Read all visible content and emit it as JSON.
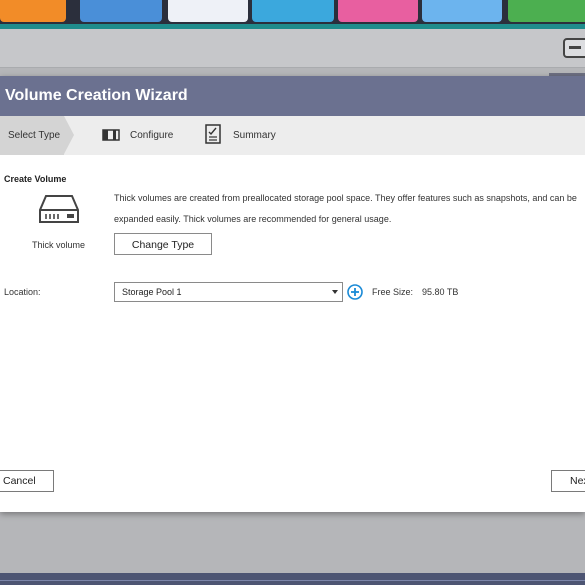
{
  "background": {
    "app_tiles": [
      {
        "name": "app-tile-orange",
        "color": "#f28c28"
      },
      {
        "name": "app-tile-blue",
        "color": "#4a8fd8"
      },
      {
        "name": "app-tile-white",
        "color": "#eef1f7"
      },
      {
        "name": "app-tile-cyan",
        "color": "#3ba8dd"
      },
      {
        "name": "app-tile-pink",
        "color": "#e85fa0"
      },
      {
        "name": "app-tile-lightblue",
        "color": "#6cb4ee"
      },
      {
        "name": "app-tile-green",
        "color": "#4caf50"
      }
    ],
    "accent_teal": "#1f8c8c"
  },
  "dialog": {
    "title": "Volume Creation Wizard",
    "title_bar_color": "#6b7190",
    "steps": [
      {
        "label": "Select Type",
        "active": true
      },
      {
        "label": "Configure",
        "icon": "configure-icon"
      },
      {
        "label": "Summary",
        "icon": "summary-icon"
      }
    ],
    "section_title": "Create Volume",
    "volume_type": {
      "icon": "hard-drive-icon",
      "label": "Thick volume",
      "description": "Thick volumes are created from preallocated storage pool space. They offer features such as snapshots, and can be expanded easily. Thick volumes are recommended for general usage.",
      "change_button": "Change Type"
    },
    "location": {
      "label": "Location:",
      "selected": "Storage Pool 1",
      "add_icon": "add-circle-icon",
      "add_icon_color": "#1a8ad6",
      "free_size_label": "Free Size:",
      "free_size_value": "95.80 TB"
    },
    "buttons": {
      "cancel": "Cancel",
      "next": "Next"
    }
  }
}
